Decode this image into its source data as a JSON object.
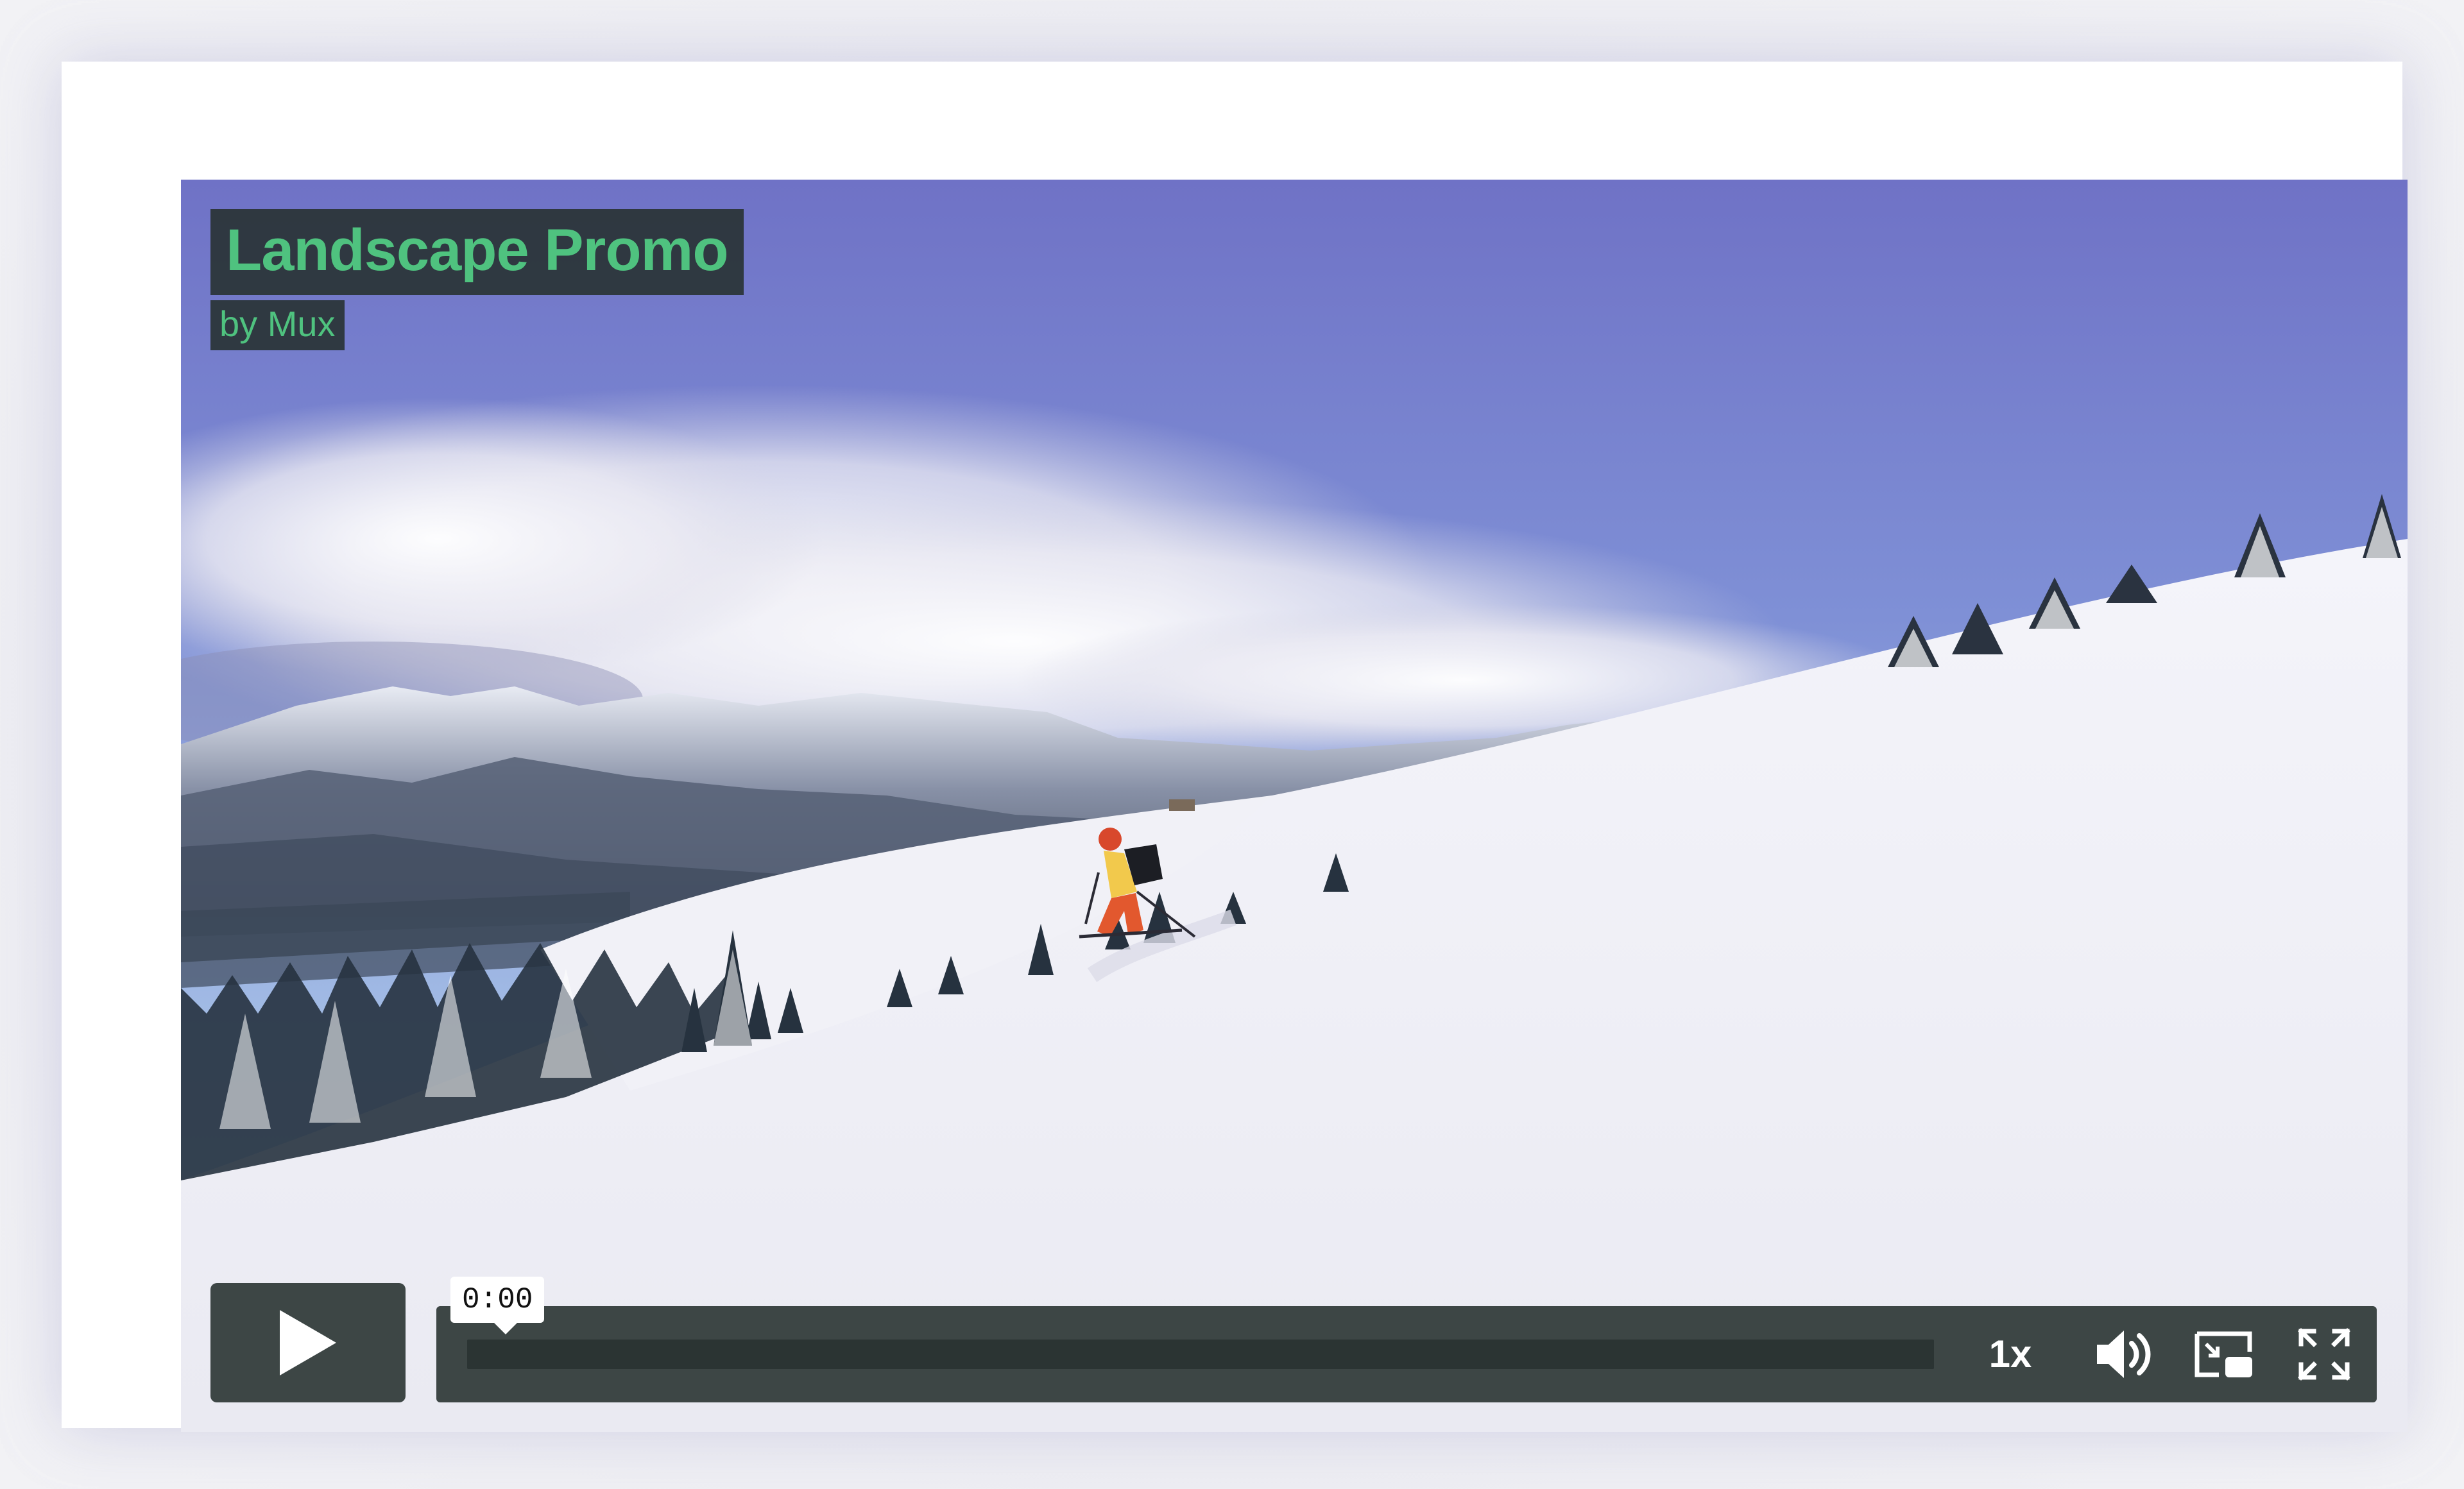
{
  "video": {
    "title": "Landscape Promo",
    "byline": "by Mux",
    "title_color": "#4fc27f"
  },
  "controls": {
    "current_time": "0:00",
    "playback_rate": "1x",
    "progress_fraction": 0,
    "icons": [
      "play-icon",
      "volume-icon",
      "picture-in-picture-icon",
      "fullscreen-icon"
    ]
  }
}
